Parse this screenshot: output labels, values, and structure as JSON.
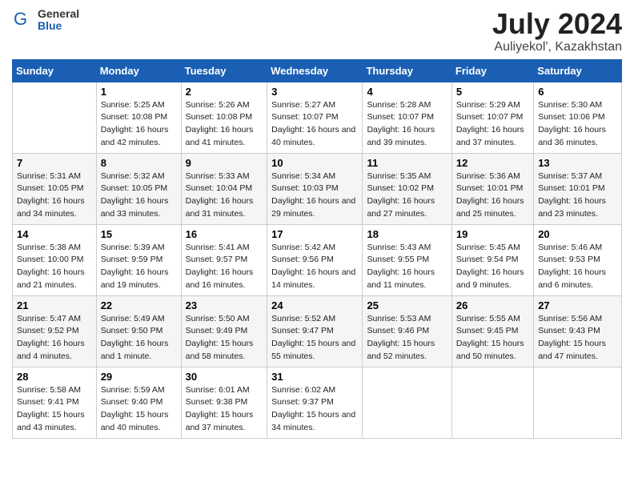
{
  "header": {
    "logo_general": "General",
    "logo_blue": "Blue",
    "title": "July 2024",
    "location": "Auliyekol', Kazakhstan"
  },
  "weekdays": [
    "Sunday",
    "Monday",
    "Tuesday",
    "Wednesday",
    "Thursday",
    "Friday",
    "Saturday"
  ],
  "weeks": [
    [
      {
        "day": null
      },
      {
        "day": 1,
        "sunrise": "5:25 AM",
        "sunset": "10:08 PM",
        "daylight": "16 hours and 42 minutes."
      },
      {
        "day": 2,
        "sunrise": "5:26 AM",
        "sunset": "10:08 PM",
        "daylight": "16 hours and 41 minutes."
      },
      {
        "day": 3,
        "sunrise": "5:27 AM",
        "sunset": "10:07 PM",
        "daylight": "16 hours and 40 minutes."
      },
      {
        "day": 4,
        "sunrise": "5:28 AM",
        "sunset": "10:07 PM",
        "daylight": "16 hours and 39 minutes."
      },
      {
        "day": 5,
        "sunrise": "5:29 AM",
        "sunset": "10:07 PM",
        "daylight": "16 hours and 37 minutes."
      },
      {
        "day": 6,
        "sunrise": "5:30 AM",
        "sunset": "10:06 PM",
        "daylight": "16 hours and 36 minutes."
      }
    ],
    [
      {
        "day": 7,
        "sunrise": "5:31 AM",
        "sunset": "10:05 PM",
        "daylight": "16 hours and 34 minutes."
      },
      {
        "day": 8,
        "sunrise": "5:32 AM",
        "sunset": "10:05 PM",
        "daylight": "16 hours and 33 minutes."
      },
      {
        "day": 9,
        "sunrise": "5:33 AM",
        "sunset": "10:04 PM",
        "daylight": "16 hours and 31 minutes."
      },
      {
        "day": 10,
        "sunrise": "5:34 AM",
        "sunset": "10:03 PM",
        "daylight": "16 hours and 29 minutes."
      },
      {
        "day": 11,
        "sunrise": "5:35 AM",
        "sunset": "10:02 PM",
        "daylight": "16 hours and 27 minutes."
      },
      {
        "day": 12,
        "sunrise": "5:36 AM",
        "sunset": "10:01 PM",
        "daylight": "16 hours and 25 minutes."
      },
      {
        "day": 13,
        "sunrise": "5:37 AM",
        "sunset": "10:01 PM",
        "daylight": "16 hours and 23 minutes."
      }
    ],
    [
      {
        "day": 14,
        "sunrise": "5:38 AM",
        "sunset": "10:00 PM",
        "daylight": "16 hours and 21 minutes."
      },
      {
        "day": 15,
        "sunrise": "5:39 AM",
        "sunset": "9:59 PM",
        "daylight": "16 hours and 19 minutes."
      },
      {
        "day": 16,
        "sunrise": "5:41 AM",
        "sunset": "9:57 PM",
        "daylight": "16 hours and 16 minutes."
      },
      {
        "day": 17,
        "sunrise": "5:42 AM",
        "sunset": "9:56 PM",
        "daylight": "16 hours and 14 minutes."
      },
      {
        "day": 18,
        "sunrise": "5:43 AM",
        "sunset": "9:55 PM",
        "daylight": "16 hours and 11 minutes."
      },
      {
        "day": 19,
        "sunrise": "5:45 AM",
        "sunset": "9:54 PM",
        "daylight": "16 hours and 9 minutes."
      },
      {
        "day": 20,
        "sunrise": "5:46 AM",
        "sunset": "9:53 PM",
        "daylight": "16 hours and 6 minutes."
      }
    ],
    [
      {
        "day": 21,
        "sunrise": "5:47 AM",
        "sunset": "9:52 PM",
        "daylight": "16 hours and 4 minutes."
      },
      {
        "day": 22,
        "sunrise": "5:49 AM",
        "sunset": "9:50 PM",
        "daylight": "16 hours and 1 minute."
      },
      {
        "day": 23,
        "sunrise": "5:50 AM",
        "sunset": "9:49 PM",
        "daylight": "15 hours and 58 minutes."
      },
      {
        "day": 24,
        "sunrise": "5:52 AM",
        "sunset": "9:47 PM",
        "daylight": "15 hours and 55 minutes."
      },
      {
        "day": 25,
        "sunrise": "5:53 AM",
        "sunset": "9:46 PM",
        "daylight": "15 hours and 52 minutes."
      },
      {
        "day": 26,
        "sunrise": "5:55 AM",
        "sunset": "9:45 PM",
        "daylight": "15 hours and 50 minutes."
      },
      {
        "day": 27,
        "sunrise": "5:56 AM",
        "sunset": "9:43 PM",
        "daylight": "15 hours and 47 minutes."
      }
    ],
    [
      {
        "day": 28,
        "sunrise": "5:58 AM",
        "sunset": "9:41 PM",
        "daylight": "15 hours and 43 minutes."
      },
      {
        "day": 29,
        "sunrise": "5:59 AM",
        "sunset": "9:40 PM",
        "daylight": "15 hours and 40 minutes."
      },
      {
        "day": 30,
        "sunrise": "6:01 AM",
        "sunset": "9:38 PM",
        "daylight": "15 hours and 37 minutes."
      },
      {
        "day": 31,
        "sunrise": "6:02 AM",
        "sunset": "9:37 PM",
        "daylight": "15 hours and 34 minutes."
      },
      {
        "day": null
      },
      {
        "day": null
      },
      {
        "day": null
      }
    ]
  ]
}
